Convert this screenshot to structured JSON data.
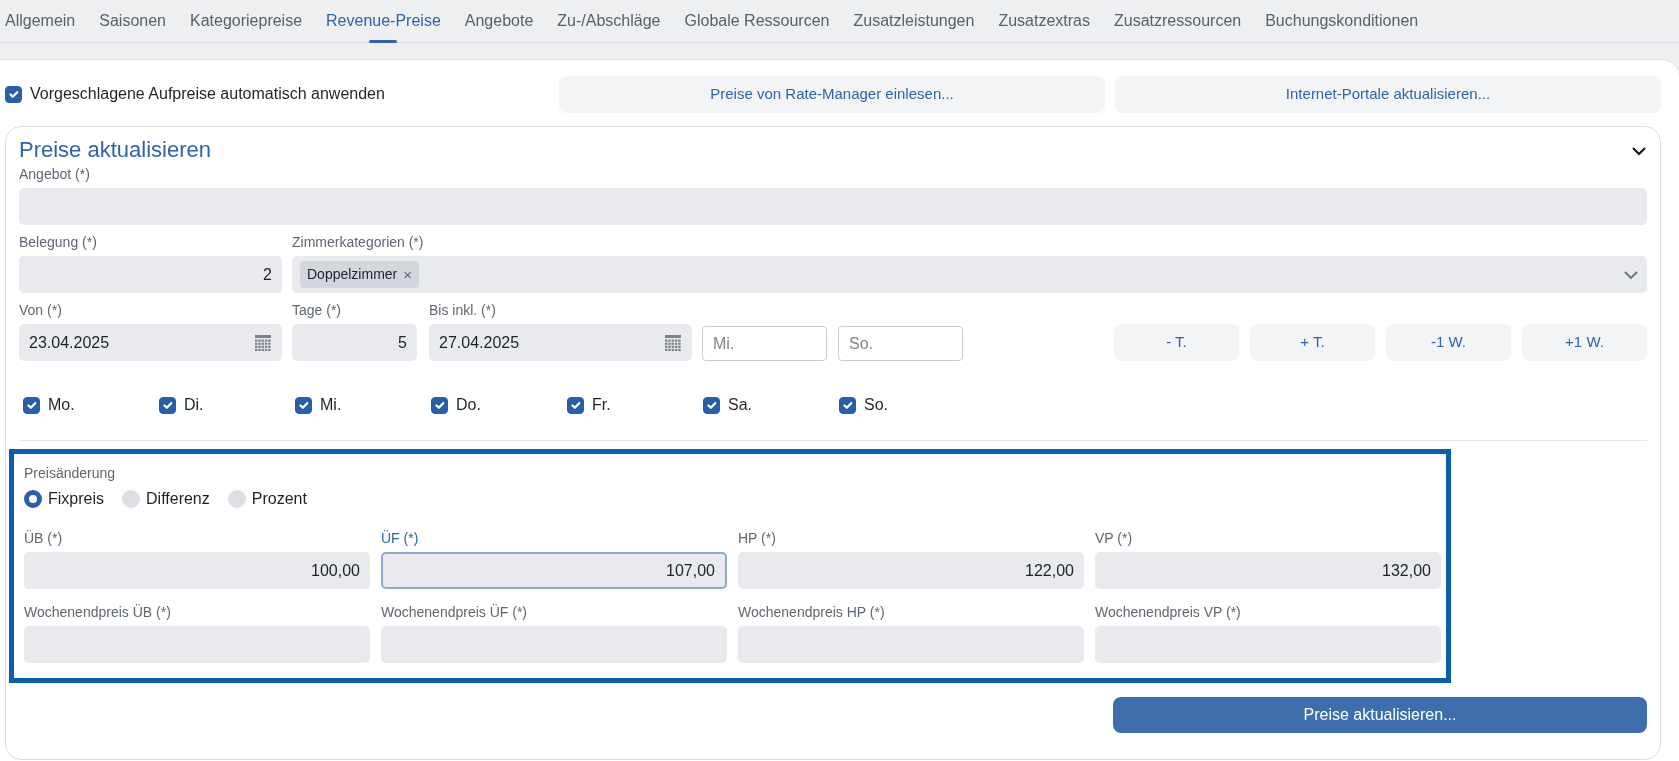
{
  "tabs": [
    {
      "label": "Allgemein",
      "selected": false
    },
    {
      "label": "Saisonen",
      "selected": false
    },
    {
      "label": "Kategoriepreise",
      "selected": false
    },
    {
      "label": "Revenue-Preise",
      "selected": true
    },
    {
      "label": "Angebote",
      "selected": false
    },
    {
      "label": "Zu-/Abschläge",
      "selected": false
    },
    {
      "label": "Globale Ressourcen",
      "selected": false
    },
    {
      "label": "Zusatzleistungen",
      "selected": false
    },
    {
      "label": "Zusatzextras",
      "selected": false
    },
    {
      "label": "Zusatzressourcen",
      "selected": false
    },
    {
      "label": "Buchungskonditionen",
      "selected": false
    }
  ],
  "auto_apply": {
    "label": "Vorgeschlagene Aufpreise automatisch anwenden",
    "checked": true
  },
  "action_buttons": [
    "Preise von Rate-Manager einlesen...",
    "Internet-Portale aktualisieren..."
  ],
  "panel": {
    "title": "Preise aktualisieren",
    "expanded": true,
    "offer": {
      "label": "Angebot (*)"
    },
    "occupancy": {
      "label": "Belegung (*)",
      "value": "2"
    },
    "room_categories": {
      "label": "Zimmerkategorien (*)",
      "chips": [
        "Doppelzimmer"
      ],
      "chip_remove": "×"
    },
    "from": {
      "label": "Von (*)",
      "value": "23.04.2025"
    },
    "days": {
      "label": "Tage (*)",
      "value": "5"
    },
    "until": {
      "label": "Bis inkl. (*)",
      "value": "27.04.2025"
    },
    "weekday_fields": [
      {
        "placeholder": "Mi."
      },
      {
        "placeholder": "So."
      }
    ],
    "shift_buttons": [
      "- T.",
      "+ T.",
      "-1 W.",
      "+1 W."
    ],
    "weekdays": [
      {
        "label": "Mo.",
        "checked": true
      },
      {
        "label": "Di.",
        "checked": true
      },
      {
        "label": "Mi.",
        "checked": true
      },
      {
        "label": "Do.",
        "checked": true
      },
      {
        "label": "Fr.",
        "checked": true
      },
      {
        "label": "Sa.",
        "checked": true
      },
      {
        "label": "So.",
        "checked": true
      }
    ],
    "price_change": {
      "label": "Preisänderung",
      "highlighted": true,
      "options": [
        {
          "label": "Fixpreis",
          "selected": true
        },
        {
          "label": "Differenz",
          "selected": false
        },
        {
          "label": "Prozent",
          "selected": false
        }
      ],
      "prices": [
        {
          "label": "ÜB (*)",
          "value": "100,00",
          "focused": false
        },
        {
          "label": "ÜF (*)",
          "value": "107,00",
          "focused": true
        },
        {
          "label": "HP (*)",
          "value": "122,00",
          "focused": false
        },
        {
          "label": "VP (*)",
          "value": "132,00",
          "focused": false
        }
      ],
      "weekend_prices": [
        {
          "label": "Wochenendpreis ÜB (*)"
        },
        {
          "label": "Wochenendpreis ÜF (*)"
        },
        {
          "label": "Wochenendpreis HP (*)"
        },
        {
          "label": "Wochenendpreis VP (*)"
        }
      ]
    },
    "submit_button": "Preise aktualisieren..."
  }
}
